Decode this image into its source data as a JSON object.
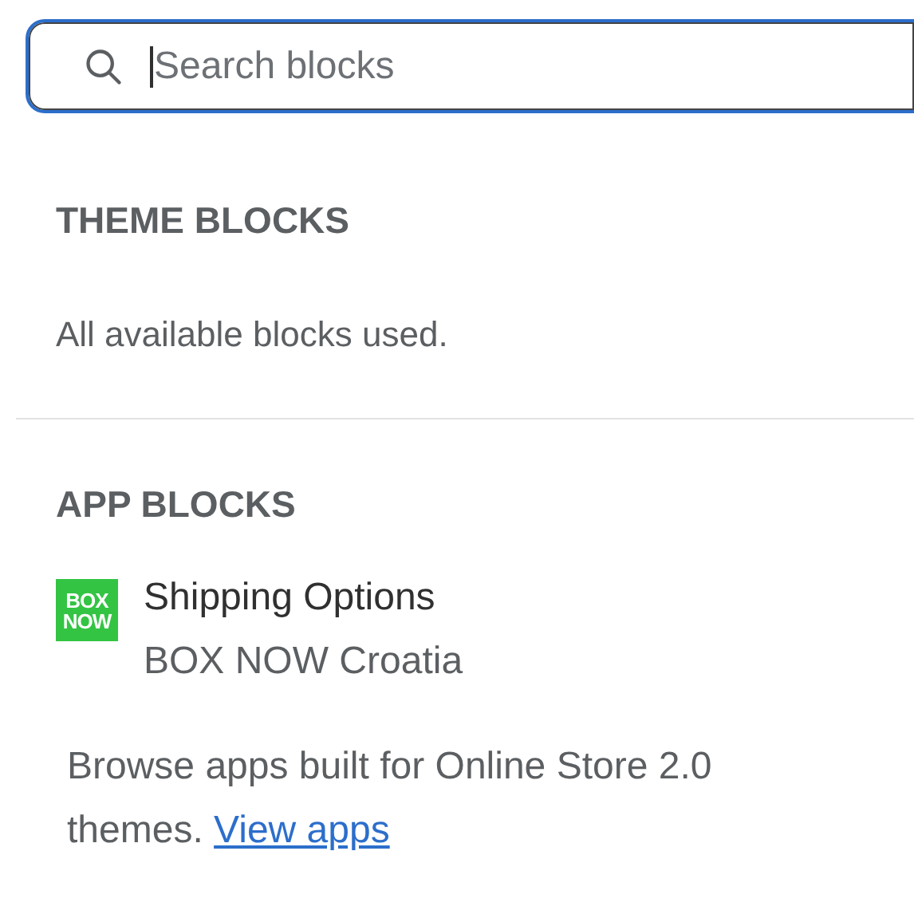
{
  "search": {
    "placeholder": "Search blocks",
    "focused": true
  },
  "theme_blocks": {
    "heading": "THEME BLOCKS",
    "message": "All available blocks used."
  },
  "app_blocks": {
    "heading": "APP BLOCKS",
    "items": [
      {
        "logo_lines": [
          "BOX",
          "NOW"
        ],
        "title": "Shipping Options",
        "subtitle": "BOX NOW Croatia"
      }
    ],
    "footer": {
      "text": "Browse apps built for Online Store 2.0 themes.",
      "link": "View apps"
    }
  }
}
